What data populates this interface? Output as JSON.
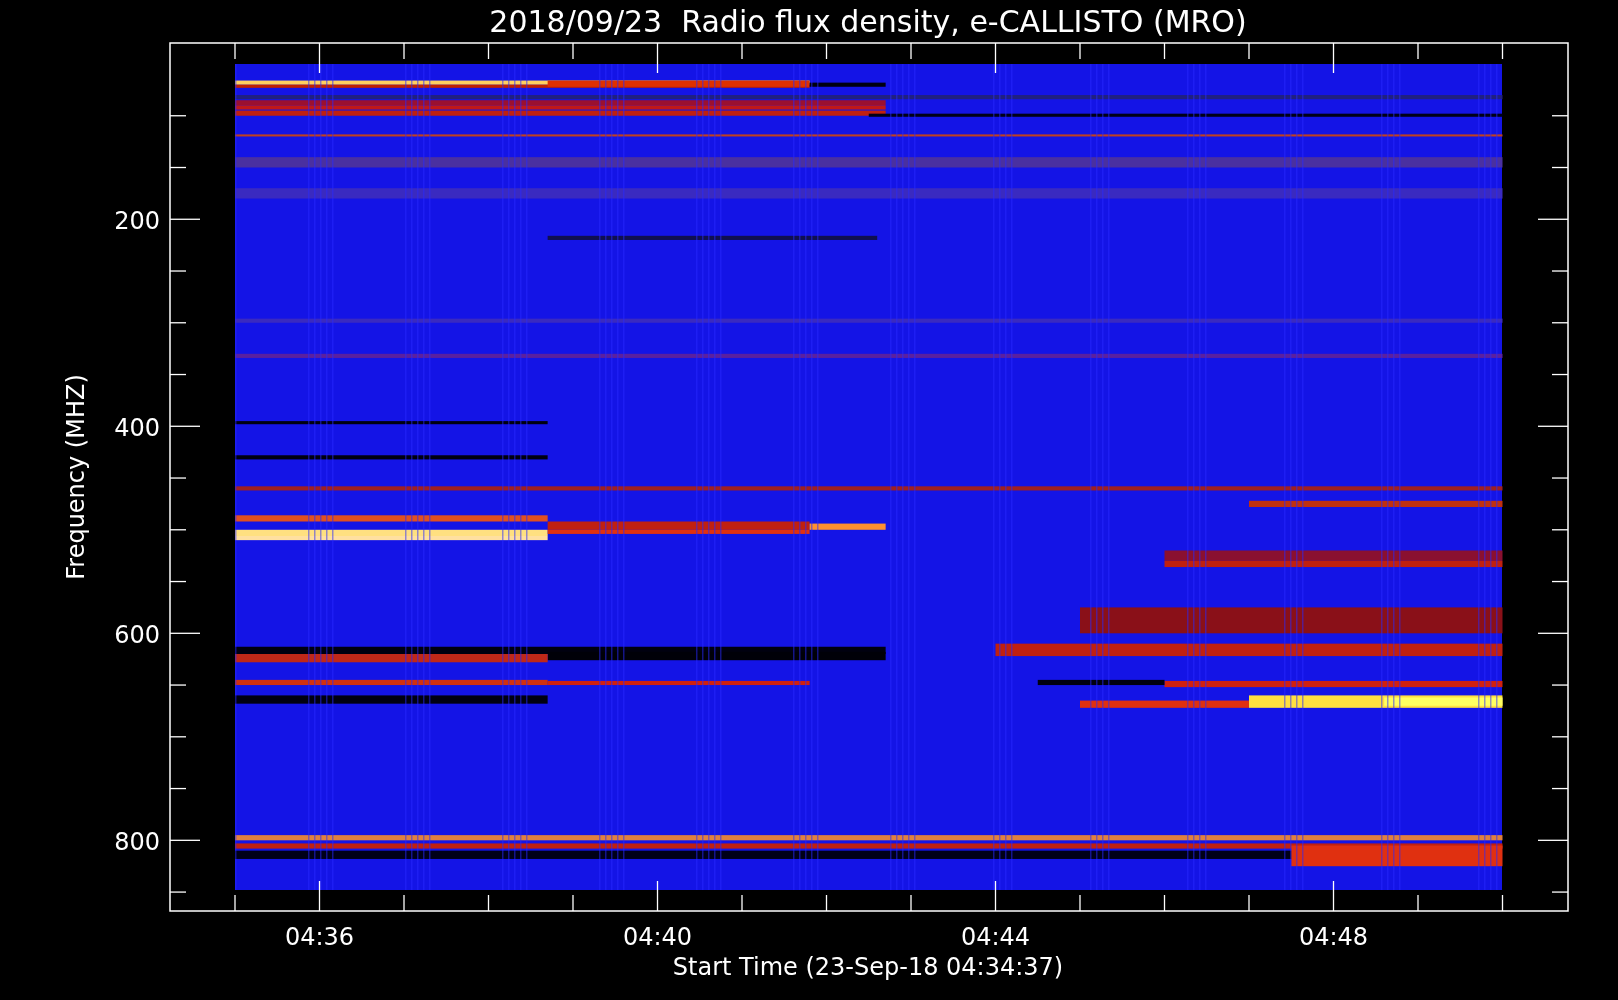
{
  "title": "2018/09/23  Radio flux density, e-CALLISTO (MRO)",
  "y_axis": {
    "label": "Frequency (MHZ)",
    "ticks": [
      "200",
      "400",
      "600",
      "800"
    ]
  },
  "x_axis": {
    "label": "Start Time (23-Sep-18 04:34:37)",
    "ticks": [
      "04:36",
      "04:40",
      "04:44",
      "04:48"
    ]
  }
}
